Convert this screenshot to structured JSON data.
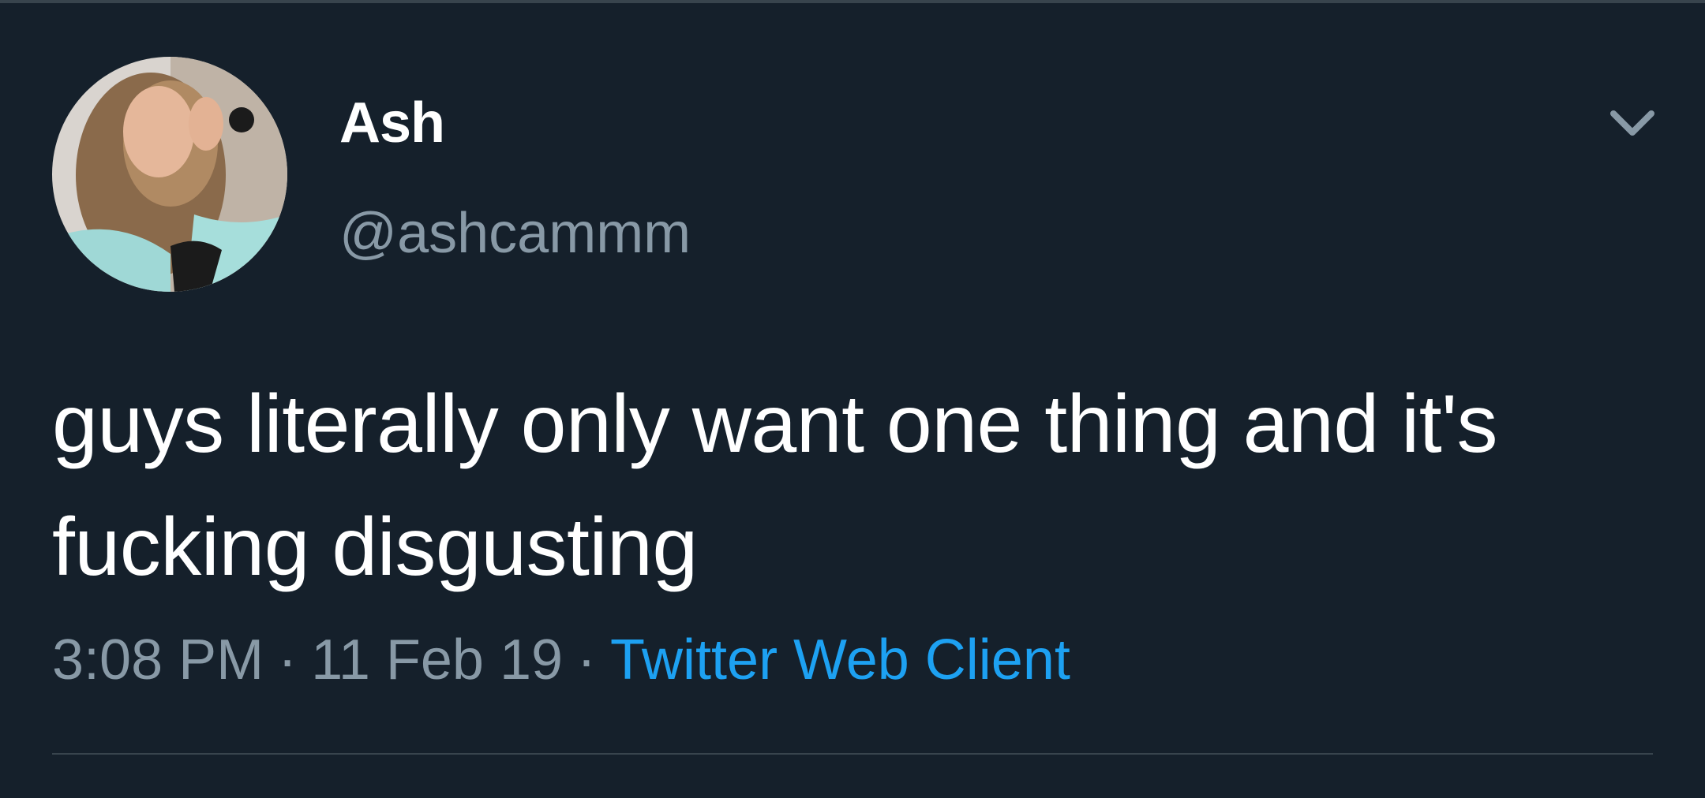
{
  "tweet": {
    "author": {
      "display_name": "Ash",
      "handle": "@ashcammm",
      "avatar_icon": "user-photo"
    },
    "menu_icon": "chevron-down-icon",
    "text": "guys literally only want one thing and it's fucking disgusting",
    "time": "3:08 PM",
    "date": "11 Feb 19",
    "separator": "·",
    "client": "Twitter Web Client"
  },
  "colors": {
    "background": "#15202b",
    "primary_text": "#ffffff",
    "secondary_text": "#8899a6",
    "accent": "#1da1f2",
    "divider": "#38444d"
  }
}
